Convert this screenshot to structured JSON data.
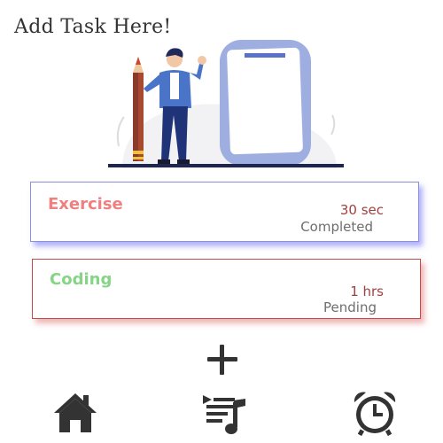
{
  "header": {
    "title": "Add Task Here!"
  },
  "tasks": [
    {
      "name": "Exercise",
      "duration": "30 sec",
      "status": "Completed",
      "name_color": "#f08080",
      "border_color": "#8a8fe0"
    },
    {
      "name": "Coding",
      "duration": "1 hrs",
      "status": "Pending",
      "name_color": "#86d486",
      "border_color": "#c24a4a"
    }
  ],
  "actions": {
    "add_icon": "plus-icon"
  },
  "bottom_nav": {
    "items": [
      {
        "icon": "home-icon"
      },
      {
        "icon": "task-list-icon"
      },
      {
        "icon": "alarm-clock-icon"
      }
    ]
  }
}
